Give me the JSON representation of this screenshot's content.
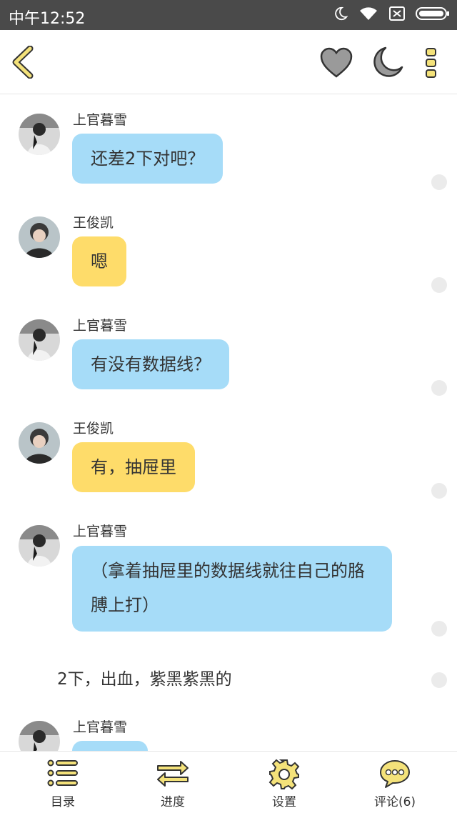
{
  "status_bar": {
    "time": "中午12:52"
  },
  "colors": {
    "blue_bubble": "#a6dcf8",
    "yellow_bubble": "#fedc6a",
    "icon_yellow": "#f4e27a",
    "icon_gray": "#9a9a9a"
  },
  "icons": {
    "back": "chevron-left-icon",
    "like": "heart-icon",
    "night_mode": "moon-icon",
    "more": "more-vertical-icon"
  },
  "messages": [
    {
      "sender": "上官暮雪",
      "text": "还差2下对吧？",
      "color": "blue"
    },
    {
      "sender": "王俊凯",
      "text": "嗯",
      "color": "yellow"
    },
    {
      "sender": "上官暮雪",
      "text": "有没有数据线？",
      "color": "blue"
    },
    {
      "sender": "王俊凯",
      "text": "有，抽屉里",
      "color": "yellow"
    },
    {
      "sender": "上官暮雪",
      "text": "（拿着抽屉里的数据线就往自己的胳膊上打）",
      "color": "blue"
    },
    {
      "narration": "2下，出血，紫黑紫黑的"
    },
    {
      "sender": "上官暮雪",
      "text": "",
      "color": "blue"
    }
  ],
  "bottom_tabs": [
    {
      "label": "目录",
      "icon": "list-icon"
    },
    {
      "label": "进度",
      "icon": "swap-arrows-icon"
    },
    {
      "label": "设置",
      "icon": "gear-icon"
    },
    {
      "label": "评论(6)",
      "icon": "comment-icon"
    }
  ]
}
